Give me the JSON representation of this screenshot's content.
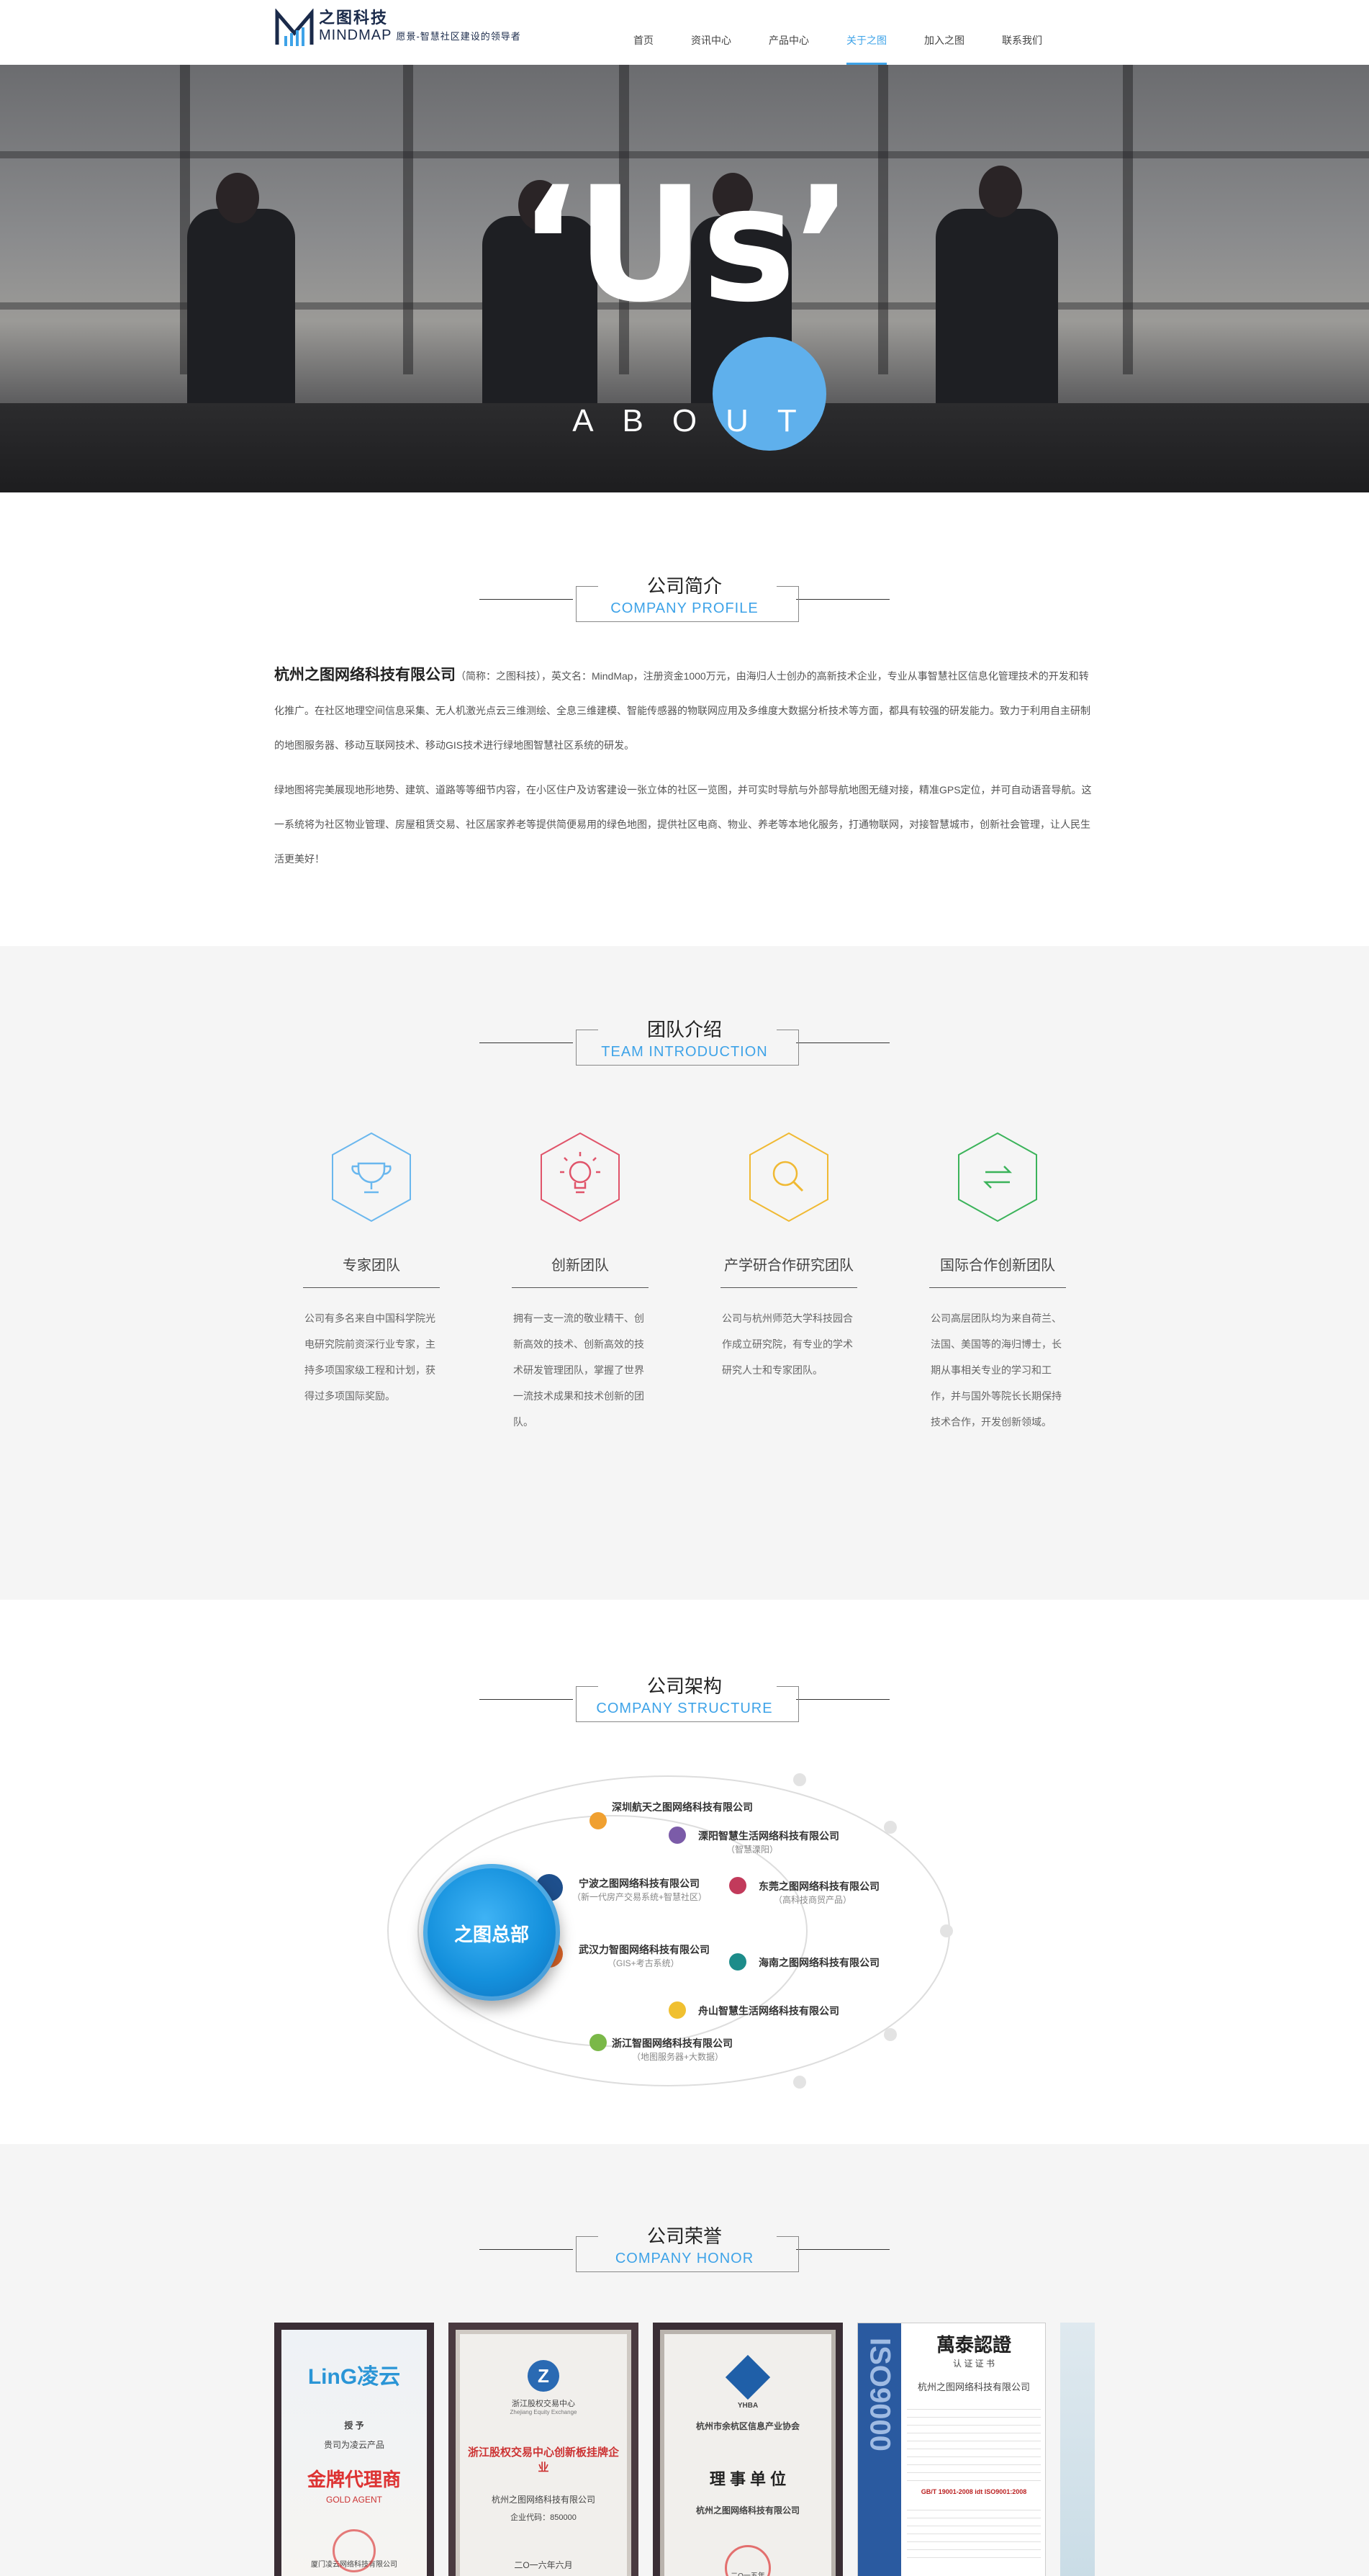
{
  "header": {
    "logo_cn": "之图科技",
    "logo_en": "MINDMAP",
    "slogan": "愿景-智慧社区建设的领导者",
    "nav": [
      "首页",
      "资讯中心",
      "产品中心",
      "关于之图",
      "加入之图",
      "联系我们"
    ],
    "active_nav": "关于之图"
  },
  "banner": {
    "big_text": "‘Us’",
    "small_text": "ABOUT",
    "accent_color": "#5fb0ec"
  },
  "profile": {
    "title_cn": "公司简介",
    "title_en": "COMPANY PROFILE",
    "company_name": "杭州之图网络科技有限公司",
    "para1": "（简称：之图科技），英文名：MindMap，注册资金1000万元，由海归人士创办的高新技术企业，专业从事智慧社区信息化管理技术的开发和转化推广。在社区地理空间信息采集、无人机激光点云三维测绘、全息三维建模、智能传感器的物联网应用及多维度大数据分析技术等方面，都具有较强的研发能力。致力于利用自主研制的地图服务器、移动互联网技术、移动GIS技术进行绿地图智慧社区系统的研发。",
    "para2": "绿地图将完美展现地形地势、建筑、道路等等细节内容，在小区住户及访客建设一张立体的社区一览图，并可实时导航与外部导航地图无缝对接，精准GPS定位，并可自动语音导航。这一系统将为社区物业管理、房屋租赁交易、社区居家养老等提供简便易用的绿色地图，提供社区电商、物业、养老等本地化服务，打通物联网，对接智慧城市，创新社会管理，让人民生活更美好！"
  },
  "team": {
    "title_cn": "团队介绍",
    "title_en": "TEAM INTRODUCTION",
    "items": [
      {
        "icon": "trophy-icon",
        "color": "#6ab7ee",
        "name": "专家团队",
        "desc": "公司有多名来自中国科学院光电研究院前资深行业专家，主持多项国家级工程和计划，获得过多项国际奖励。"
      },
      {
        "icon": "lightbulb-icon",
        "color": "#e0546a",
        "name": "创新团队",
        "desc": "拥有一支一流的敬业精干、创新高效的技术、创新高效的技术研发管理团队，掌握了世界一流技术成果和技术创新的团队。"
      },
      {
        "icon": "magnifier-icon",
        "color": "#f0b933",
        "name": "产学研合作研究团队",
        "desc": "公司与杭州师范大学科技园合作成立研究院，有专业的学术研究人士和专家团队。"
      },
      {
        "icon": "exchange-icon",
        "color": "#3bb35a",
        "name": "国际合作创新团队",
        "desc": "公司高层团队均为来自荷兰、法国、美国等的海归博士，长期从事相关专业的学习和工作，并与国外等院长长期保持技术合作，开发创新领域。"
      }
    ]
  },
  "structure": {
    "title_cn": "公司架构",
    "title_en": "COMPANY STRUCTURE",
    "hq": "之图总部",
    "nodes": [
      {
        "name": "深圳航天之图网络科技有限公司",
        "sub": "",
        "color": "#f0a030"
      },
      {
        "name": "溧阳智慧生活网络科技有限公司",
        "sub": "（智慧溧阳）",
        "color": "#7b5ba8"
      },
      {
        "name": "宁波之图网络科技有限公司",
        "sub": "（新一代房产交易系统+智慧社区）",
        "color": "#1e4f8c"
      },
      {
        "name": "东莞之图网络科技有限公司",
        "sub": "（高科技商贸产品）",
        "color": "#c23a5b"
      },
      {
        "name": "武汉力智图网络科技有限公司",
        "sub": "（GIS+考古系统）",
        "color": "#e0672a"
      },
      {
        "name": "海南之图网络科技有限公司",
        "sub": "",
        "color": "#1c8c8a"
      },
      {
        "name": "舟山智慧生活网络科技有限公司",
        "sub": "",
        "color": "#f0c030"
      },
      {
        "name": "浙江智图网络科技有限公司",
        "sub": "（地图服务器+大数据）",
        "color": "#7ab848"
      }
    ]
  },
  "honor": {
    "title_cn": "公司荣誉",
    "title_en": "COMPANY HONOR",
    "certs": [
      {
        "brand": "LinG凌云",
        "line1": "授 予",
        "line2": "贵司为凌云产品",
        "main": "金牌代理商",
        "en": "GOLD AGENT",
        "foot": "厦门凌云网络科技有限公司"
      },
      {
        "brand": "浙江股权交易中心",
        "line1": "Zhejiang Equity Exchange",
        "main": "浙江股权交易中心创新板挂牌企业",
        "line2": "杭州之图网络科技有限公司",
        "code": "企业代码：850000",
        "foot": "二O一六年六月"
      },
      {
        "brand": "YHBA",
        "line1": "杭州市余杭区信息产业协会",
        "main": "理 事 单 位",
        "line2": "杭州之图网络科技有限公司",
        "foot": "二O一五年"
      },
      {
        "brand": "萬泰認證",
        "line1": "认 证 证 书",
        "line2": "杭州之图网络科技有限公司",
        "main": "GB/T 19001-2008 idt ISO9001:2008",
        "side": "ISO9000"
      }
    ]
  }
}
